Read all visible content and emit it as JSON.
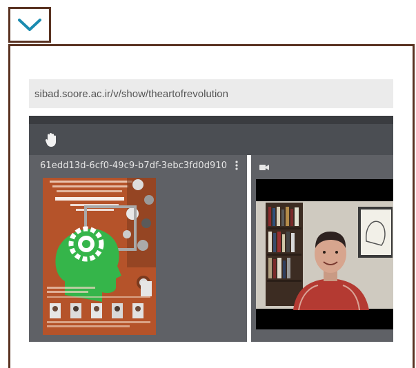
{
  "collapse_toggle": {
    "icon": "chevron-down-icon",
    "color": "#1b8bb0"
  },
  "browser": {
    "url": "sibad.soore.ac.ir/v/show/theartofrevolution"
  },
  "meeting": {
    "toolbar": {
      "raise_hand_icon": "hand-icon"
    },
    "shared_tile": {
      "title": "61edd13d-6cf0-49c9-b7df-3ebc3fd0d910",
      "menu_icon": "kebab-menu-icon"
    },
    "camera_tile": {
      "icon": "video-camera-icon"
    }
  },
  "colors": {
    "frame_border": "#5a3322",
    "toolbar_bg": "#4b4e53",
    "tile_bg": "#5f6166",
    "poster_bg": "#b5532a",
    "poster_head": "#35b54a"
  }
}
